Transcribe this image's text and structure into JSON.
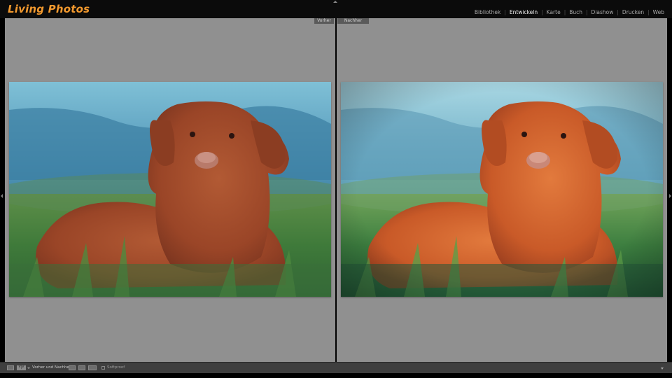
{
  "app": {
    "title": "Living Photos"
  },
  "modules": [
    {
      "label": "Bibliothek",
      "active": false
    },
    {
      "label": "Entwickeln",
      "active": true
    },
    {
      "label": "Karte",
      "active": false
    },
    {
      "label": "Buch",
      "active": false
    },
    {
      "label": "Diashow",
      "active": false
    },
    {
      "label": "Drucken",
      "active": false
    },
    {
      "label": "Web",
      "active": false
    }
  ],
  "module_separator": "|",
  "compare": {
    "before_label": "Vorher",
    "after_label": "Nachher"
  },
  "toolbar": {
    "view_mode_label": "Y|Y",
    "before_after_label": "Vorher und Nachher:",
    "softproof_label": "Softproof",
    "softproof_checked": false
  },
  "colors": {
    "accent": "#f2992e",
    "panel": "#909090",
    "toolbar": "#3f3f3f"
  },
  "icons": [
    "loupe-view-icon",
    "before-after-icon",
    "swap-left-right-icon",
    "copy-settings-icon",
    "swap-settings-icon",
    "collapse-chevron-icon"
  ]
}
